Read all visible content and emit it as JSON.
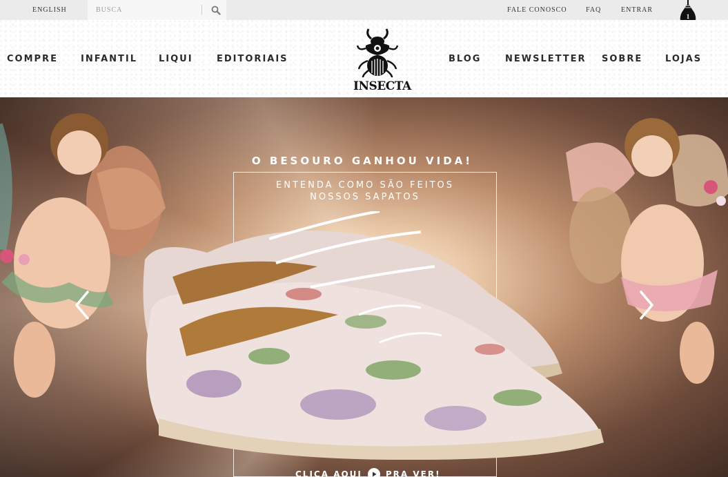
{
  "topbar": {
    "language": "ENGLISH",
    "search_placeholder": "BUSCA",
    "links": [
      "FALE CONOSCO",
      "FAQ",
      "ENTRAR"
    ],
    "cart_count": "1"
  },
  "nav": {
    "left": [
      "COMPRE",
      "INFANTIL",
      "LIQUI",
      "EDITORIAIS"
    ],
    "right": [
      "BLOG",
      "NEWSLETTER",
      "SOBRE",
      "LOJAS"
    ],
    "logo_text": "INSECTA"
  },
  "hero": {
    "headline": "O BESOURO GANHOU VIDA!",
    "subhead_line1": "ENTENDA COMO SÃO FEITOS",
    "subhead_line2": "NOSSOS SAPATOS",
    "cta_left": "CLICA AQUI",
    "cta_right": "PRA VER!",
    "icons": {
      "prev": "chevron-left-icon",
      "next": "chevron-right-icon",
      "play": "play-icon"
    }
  }
}
